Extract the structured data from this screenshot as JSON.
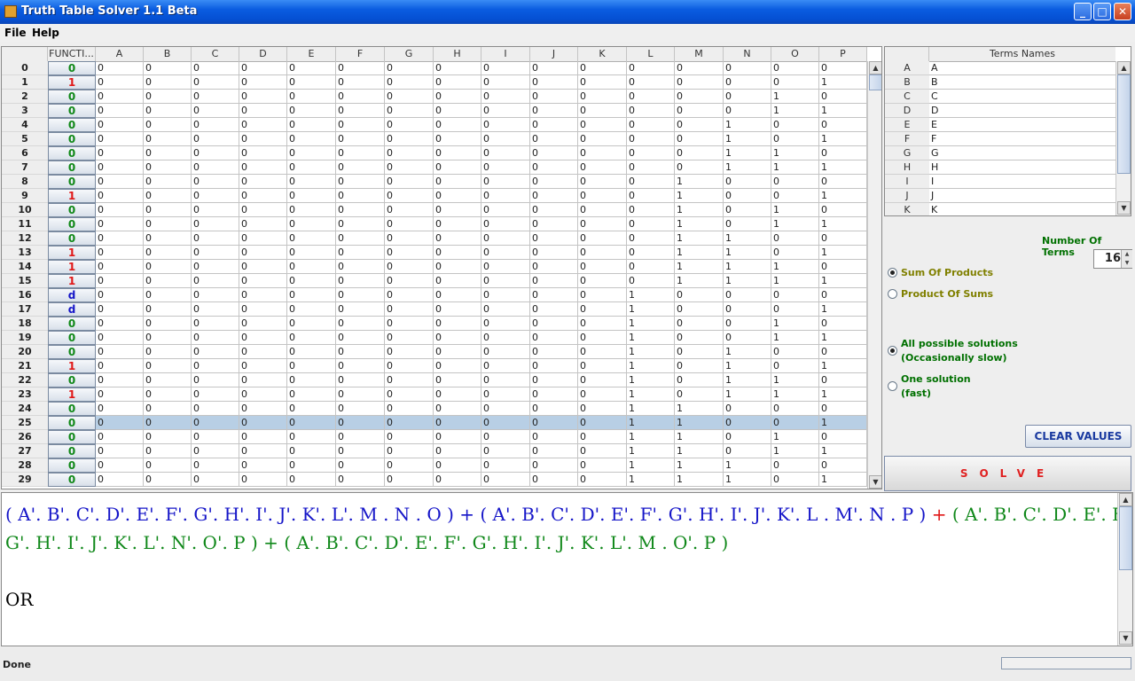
{
  "window": {
    "title": "Truth Table Solver 1.1 Beta",
    "minimize": "_",
    "maximize": "□",
    "close": "✕"
  },
  "menu": [
    "File",
    "Help"
  ],
  "table": {
    "headers": [
      "FUNCTI...",
      "A",
      "B",
      "C",
      "D",
      "E",
      "F",
      "G",
      "H",
      "I",
      "J",
      "K",
      "L",
      "M",
      "N",
      "O",
      "P"
    ],
    "functions": [
      "0",
      "1",
      "0",
      "0",
      "0",
      "0",
      "0",
      "0",
      "0",
      "1",
      "0",
      "0",
      "0",
      "1",
      "1",
      "1",
      "d",
      "d",
      "0",
      "0",
      "0",
      "1",
      "0",
      "1",
      "0",
      "0",
      "0",
      "0",
      "0",
      "0"
    ],
    "selected_row": 25,
    "rows": [
      [
        "0",
        "0",
        "0",
        "0",
        "0",
        "0",
        "0",
        "0",
        "0",
        "0",
        "0",
        "0",
        "0",
        "0",
        "0",
        "0"
      ],
      [
        "0",
        "0",
        "0",
        "0",
        "0",
        "0",
        "0",
        "0",
        "0",
        "0",
        "0",
        "0",
        "0",
        "0",
        "0",
        "1"
      ],
      [
        "0",
        "0",
        "0",
        "0",
        "0",
        "0",
        "0",
        "0",
        "0",
        "0",
        "0",
        "0",
        "0",
        "0",
        "1",
        "0"
      ],
      [
        "0",
        "0",
        "0",
        "0",
        "0",
        "0",
        "0",
        "0",
        "0",
        "0",
        "0",
        "0",
        "0",
        "0",
        "1",
        "1"
      ],
      [
        "0",
        "0",
        "0",
        "0",
        "0",
        "0",
        "0",
        "0",
        "0",
        "0",
        "0",
        "0",
        "0",
        "1",
        "0",
        "0"
      ],
      [
        "0",
        "0",
        "0",
        "0",
        "0",
        "0",
        "0",
        "0",
        "0",
        "0",
        "0",
        "0",
        "0",
        "1",
        "0",
        "1"
      ],
      [
        "0",
        "0",
        "0",
        "0",
        "0",
        "0",
        "0",
        "0",
        "0",
        "0",
        "0",
        "0",
        "0",
        "1",
        "1",
        "0"
      ],
      [
        "0",
        "0",
        "0",
        "0",
        "0",
        "0",
        "0",
        "0",
        "0",
        "0",
        "0",
        "0",
        "0",
        "1",
        "1",
        "1"
      ],
      [
        "0",
        "0",
        "0",
        "0",
        "0",
        "0",
        "0",
        "0",
        "0",
        "0",
        "0",
        "0",
        "1",
        "0",
        "0",
        "0"
      ],
      [
        "0",
        "0",
        "0",
        "0",
        "0",
        "0",
        "0",
        "0",
        "0",
        "0",
        "0",
        "0",
        "1",
        "0",
        "0",
        "1"
      ],
      [
        "0",
        "0",
        "0",
        "0",
        "0",
        "0",
        "0",
        "0",
        "0",
        "0",
        "0",
        "0",
        "1",
        "0",
        "1",
        "0"
      ],
      [
        "0",
        "0",
        "0",
        "0",
        "0",
        "0",
        "0",
        "0",
        "0",
        "0",
        "0",
        "0",
        "1",
        "0",
        "1",
        "1"
      ],
      [
        "0",
        "0",
        "0",
        "0",
        "0",
        "0",
        "0",
        "0",
        "0",
        "0",
        "0",
        "0",
        "1",
        "1",
        "0",
        "0"
      ],
      [
        "0",
        "0",
        "0",
        "0",
        "0",
        "0",
        "0",
        "0",
        "0",
        "0",
        "0",
        "0",
        "1",
        "1",
        "0",
        "1"
      ],
      [
        "0",
        "0",
        "0",
        "0",
        "0",
        "0",
        "0",
        "0",
        "0",
        "0",
        "0",
        "0",
        "1",
        "1",
        "1",
        "0"
      ],
      [
        "0",
        "0",
        "0",
        "0",
        "0",
        "0",
        "0",
        "0",
        "0",
        "0",
        "0",
        "0",
        "1",
        "1",
        "1",
        "1"
      ],
      [
        "0",
        "0",
        "0",
        "0",
        "0",
        "0",
        "0",
        "0",
        "0",
        "0",
        "0",
        "1",
        "0",
        "0",
        "0",
        "0"
      ],
      [
        "0",
        "0",
        "0",
        "0",
        "0",
        "0",
        "0",
        "0",
        "0",
        "0",
        "0",
        "1",
        "0",
        "0",
        "0",
        "1"
      ],
      [
        "0",
        "0",
        "0",
        "0",
        "0",
        "0",
        "0",
        "0",
        "0",
        "0",
        "0",
        "1",
        "0",
        "0",
        "1",
        "0"
      ],
      [
        "0",
        "0",
        "0",
        "0",
        "0",
        "0",
        "0",
        "0",
        "0",
        "0",
        "0",
        "1",
        "0",
        "0",
        "1",
        "1"
      ],
      [
        "0",
        "0",
        "0",
        "0",
        "0",
        "0",
        "0",
        "0",
        "0",
        "0",
        "0",
        "1",
        "0",
        "1",
        "0",
        "0"
      ],
      [
        "0",
        "0",
        "0",
        "0",
        "0",
        "0",
        "0",
        "0",
        "0",
        "0",
        "0",
        "1",
        "0",
        "1",
        "0",
        "1"
      ],
      [
        "0",
        "0",
        "0",
        "0",
        "0",
        "0",
        "0",
        "0",
        "0",
        "0",
        "0",
        "1",
        "0",
        "1",
        "1",
        "0"
      ],
      [
        "0",
        "0",
        "0",
        "0",
        "0",
        "0",
        "0",
        "0",
        "0",
        "0",
        "0",
        "1",
        "0",
        "1",
        "1",
        "1"
      ],
      [
        "0",
        "0",
        "0",
        "0",
        "0",
        "0",
        "0",
        "0",
        "0",
        "0",
        "0",
        "1",
        "1",
        "0",
        "0",
        "0"
      ],
      [
        "0",
        "0",
        "0",
        "0",
        "0",
        "0",
        "0",
        "0",
        "0",
        "0",
        "0",
        "1",
        "1",
        "0",
        "0",
        "1"
      ],
      [
        "0",
        "0",
        "0",
        "0",
        "0",
        "0",
        "0",
        "0",
        "0",
        "0",
        "0",
        "1",
        "1",
        "0",
        "1",
        "0"
      ],
      [
        "0",
        "0",
        "0",
        "0",
        "0",
        "0",
        "0",
        "0",
        "0",
        "0",
        "0",
        "1",
        "1",
        "0",
        "1",
        "1"
      ],
      [
        "0",
        "0",
        "0",
        "0",
        "0",
        "0",
        "0",
        "0",
        "0",
        "0",
        "0",
        "1",
        "1",
        "1",
        "0",
        "0"
      ],
      [
        "0",
        "0",
        "0",
        "0",
        "0",
        "0",
        "0",
        "0",
        "0",
        "0",
        "0",
        "1",
        "1",
        "1",
        "0",
        "1"
      ]
    ]
  },
  "terms": {
    "header": "Terms Names",
    "rows": [
      [
        "A",
        "A"
      ],
      [
        "B",
        "B"
      ],
      [
        "C",
        "C"
      ],
      [
        "D",
        "D"
      ],
      [
        "E",
        "E"
      ],
      [
        "F",
        "F"
      ],
      [
        "G",
        "G"
      ],
      [
        "H",
        "H"
      ],
      [
        "I",
        "I"
      ],
      [
        "J",
        "J"
      ],
      [
        "K",
        "K"
      ]
    ]
  },
  "options": {
    "number_of_terms_label": "Number Of Terms",
    "number_of_terms": "16",
    "sum_of_products": "Sum Of Products",
    "product_of_sums": "Product Of Sums",
    "all_solutions_1": "All possible solutions",
    "all_solutions_2": "(Occasionally slow)",
    "one_solution_1": "One solution",
    "one_solution_2": "(fast)",
    "clear_values": "CLEAR VALUES",
    "solve": "SOLVE"
  },
  "colors": {
    "one": "#e01818",
    "zero": "#108818",
    "dontcare": "#1515c8"
  },
  "output": {
    "lines": [
      [
        [
          "b",
          "( A'. B'. C'. D'. E'. F'. G'. H'. I'. J'. K'. L'. M . N . O ) + ( A'. B'. C'. D'. E'. F'. G'. H'. I'. J'. K'. L . M'. N . P ) "
        ],
        [
          "r",
          "+ "
        ],
        [
          "g",
          "( A'. B'. C'. D'. E'. F'."
        ]
      ],
      [
        [
          "g",
          "G'. H'. I'. J'. K'. L'. N'. O'. P ) + ( A'. B'. C'. D'. E'. F'. G'. H'. I'. J'. K'. L'. M . O'. P )"
        ]
      ],
      [
        [
          "k",
          ""
        ]
      ],
      [
        [
          "k",
          "OR"
        ]
      ],
      [
        [
          "k",
          ""
        ]
      ],
      [
        [
          "b",
          "( A'. B'. C'. D'. E'. F'. G'. H'. I'. J'. K'. L'. M . N . O ) + ( A'. B'. C'. D'. E'. F'. G'. H'. I'. J'. K'. L . M'. N . P ) "
        ],
        [
          "r",
          "+ "
        ],
        [
          "g",
          "( A'. B'. C'. D'. E'. F'."
        ]
      ]
    ]
  },
  "status": "Done"
}
